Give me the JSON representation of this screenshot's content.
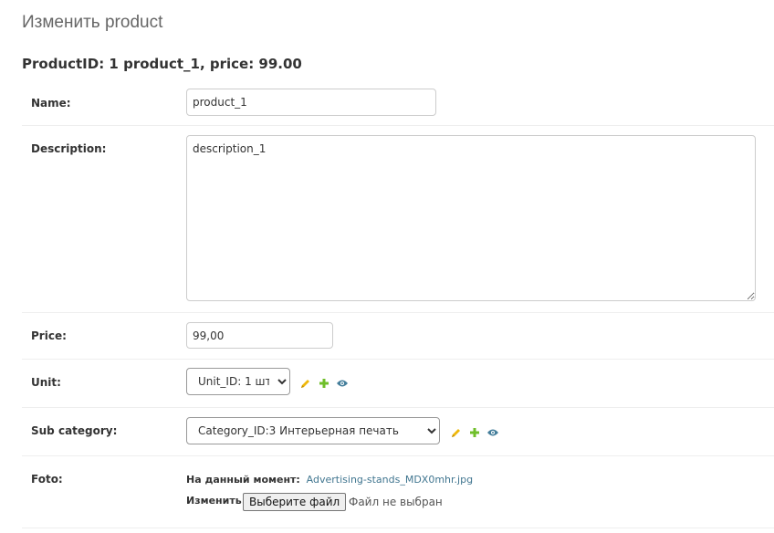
{
  "header": {
    "title": "Изменить product",
    "object_title": "ProductID: 1 product_1, price: 99.00"
  },
  "form": {
    "name": {
      "label": "Name:",
      "value": "product_1"
    },
    "description": {
      "label": "Description:",
      "value": "description_1"
    },
    "price": {
      "label": "Price:",
      "value": "99,00"
    },
    "unit": {
      "label": "Unit:",
      "selected": "Unit_ID: 1 шт."
    },
    "sub_category": {
      "label": "Sub category:",
      "selected": "Category_ID:3 Интерьерная печать"
    },
    "foto": {
      "label": "Foto:",
      "current_label": "На данный момент:",
      "current_file": "Advertising-stands_MDX0mhr.jpg",
      "change_label": "Изменить:",
      "choose_button": "Выберите файл",
      "no_file_text": "Файл не выбран"
    }
  },
  "icons": {
    "edit": "pencil-icon",
    "add": "plus-icon",
    "view": "eye-icon",
    "colors": {
      "edit": "#efb80b",
      "add": "#70bf2b",
      "view": "#447e9b"
    }
  },
  "colors": {
    "link": "#417690",
    "border": "#cccccc",
    "divider": "#eeeeee"
  }
}
